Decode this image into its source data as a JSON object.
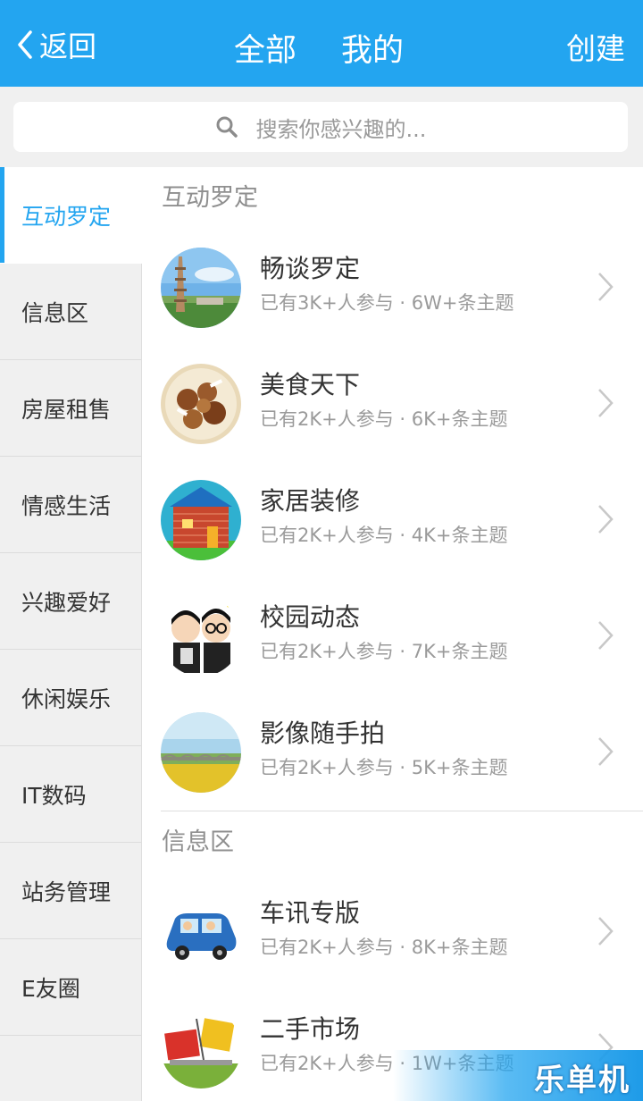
{
  "header": {
    "back_label": "返回",
    "tab_all": "全部",
    "tab_mine": "我的",
    "create_label": "创建",
    "bg_color": "#23a5f0"
  },
  "search": {
    "placeholder": "搜索你感兴趣的..."
  },
  "sidebar": {
    "items": [
      {
        "label": "互动罗定",
        "active": true
      },
      {
        "label": "信息区"
      },
      {
        "label": "房屋租售"
      },
      {
        "label": "情感生活"
      },
      {
        "label": "兴趣爱好"
      },
      {
        "label": "休闲娱乐"
      },
      {
        "label": "IT数码"
      },
      {
        "label": "站务管理"
      },
      {
        "label": "E友圈"
      }
    ]
  },
  "sections": [
    {
      "title": "互动罗定",
      "items": [
        {
          "title": "畅谈罗定",
          "meta": "已有3K+人参与 · 6W+条主题",
          "icon": "pagoda-photo"
        },
        {
          "title": "美食天下",
          "meta": "已有2K+人参与 · 6K+条主题",
          "icon": "food-photo"
        },
        {
          "title": "家居装修",
          "meta": "已有2K+人参与 · 4K+条主题",
          "icon": "house-icon"
        },
        {
          "title": "校园动态",
          "meta": "已有2K+人参与 · 7K+条主题",
          "icon": "students-icon"
        },
        {
          "title": "影像随手拍",
          "meta": "已有2K+人参与 · 5K+条主题",
          "icon": "bridge-landscape-photo"
        }
      ]
    },
    {
      "title": "信息区",
      "items": [
        {
          "title": "车讯专版",
          "meta": "已有2K+人参与 · 8K+条主题",
          "icon": "car-icon"
        },
        {
          "title": "二手市场",
          "meta": "已有2K+人参与 · 1W+条主题",
          "icon": "buy-sell-icon"
        }
      ]
    }
  ],
  "watermark": {
    "text": "乐单机"
  }
}
